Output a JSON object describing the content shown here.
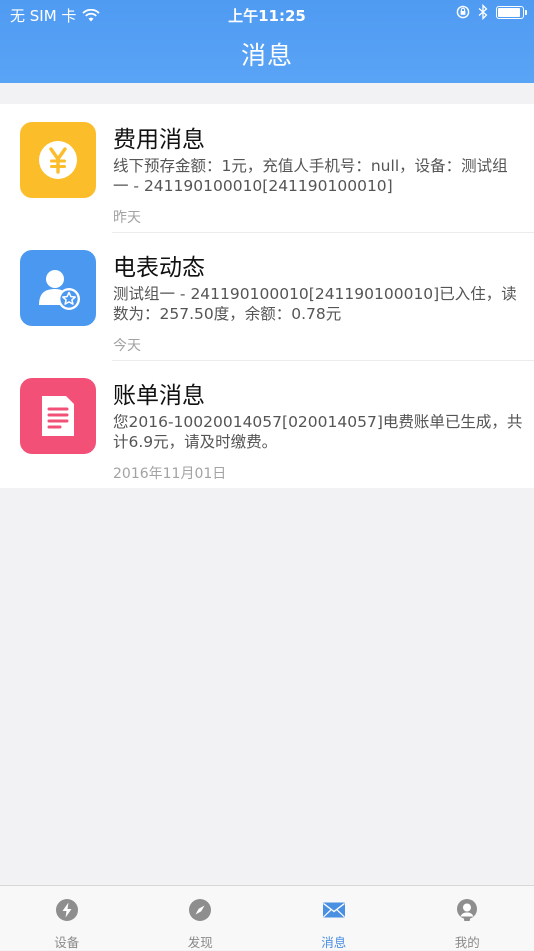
{
  "status_bar": {
    "carrier": "无 SIM 卡",
    "time": "上午11:25"
  },
  "header": {
    "title": "消息"
  },
  "messages": [
    {
      "icon": "yen-coin-icon",
      "icon_color": "#fbbd2a",
      "title": "费用消息",
      "desc": "线下预存金额：1元，充值人手机号：null，设备：测试组一 - 241190100010[241190100010]",
      "date": "昨天"
    },
    {
      "icon": "user-star-icon",
      "icon_color": "#4b98f1",
      "title": "电表动态",
      "desc": "测试组一 - 241190100010[241190100010]已入住，读数为：257.50度，余额：0.78元",
      "date": "今天"
    },
    {
      "icon": "document-icon",
      "icon_color": "#f25077",
      "title": "账单消息",
      "desc": "您2016-10020014057[020014057]电费账单已生成，共计6.9元，请及时缴费。",
      "date": "2016年11月01日"
    }
  ],
  "tabbar": {
    "tabs": [
      {
        "label": "设备",
        "icon": "lightning-icon"
      },
      {
        "label": "发现",
        "icon": "compass-icon"
      },
      {
        "label": "消息",
        "icon": "mail-icon",
        "active": true
      },
      {
        "label": "我的",
        "icon": "person-icon"
      }
    ],
    "active_color": "#4a90e2"
  }
}
